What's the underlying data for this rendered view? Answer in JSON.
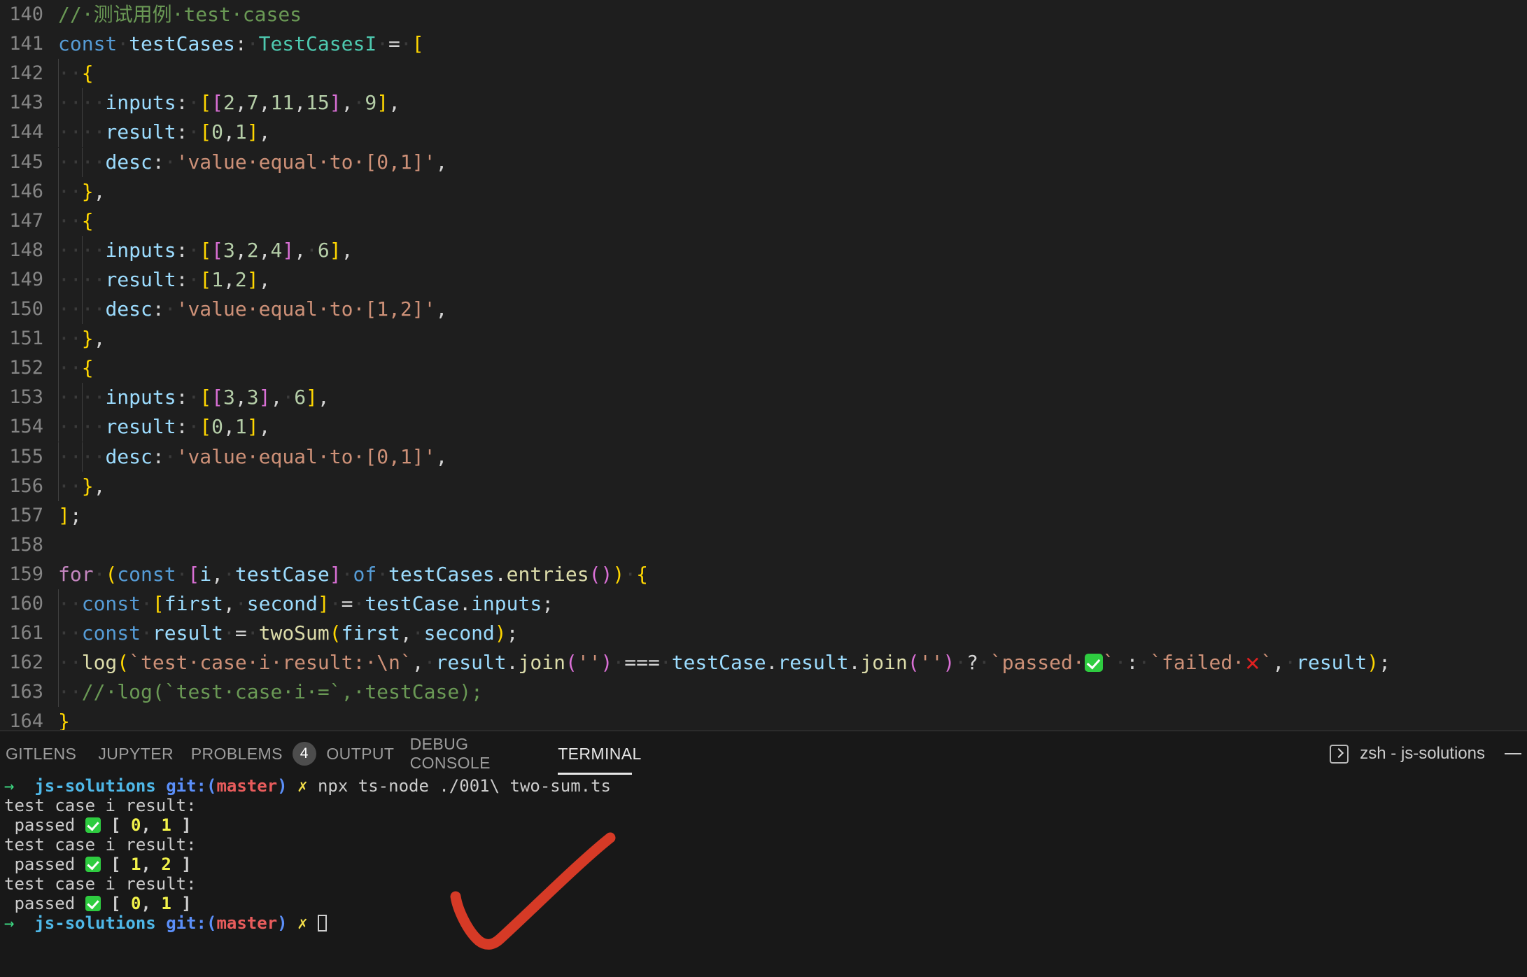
{
  "editor": {
    "first_line_number": 140,
    "lines": [
      {
        "n": 140,
        "text": "// 测试用例 test cases"
      },
      {
        "n": 141,
        "text": "const testCases: TestCasesI = ["
      },
      {
        "n": 142,
        "text": "  {"
      },
      {
        "n": 143,
        "text": "    inputs: [[2,7,11,15], 9],"
      },
      {
        "n": 144,
        "text": "    result: [0,1],"
      },
      {
        "n": 145,
        "text": "    desc: 'value equal to [0,1]',"
      },
      {
        "n": 146,
        "text": "  },"
      },
      {
        "n": 147,
        "text": "  {"
      },
      {
        "n": 148,
        "text": "    inputs: [[3,2,4], 6],"
      },
      {
        "n": 149,
        "text": "    result: [1,2],"
      },
      {
        "n": 150,
        "text": "    desc: 'value equal to [1,2]',"
      },
      {
        "n": 151,
        "text": "  },"
      },
      {
        "n": 152,
        "text": "  {"
      },
      {
        "n": 153,
        "text": "    inputs: [[3,3], 6],"
      },
      {
        "n": 154,
        "text": "    result: [0,1],"
      },
      {
        "n": 155,
        "text": "    desc: 'value equal to [0,1]',"
      },
      {
        "n": 156,
        "text": "  },"
      },
      {
        "n": 157,
        "text": "];"
      },
      {
        "n": 158,
        "text": ""
      },
      {
        "n": 159,
        "text": "for (const [i, testCase] of testCases.entries()) {"
      },
      {
        "n": 160,
        "text": "  const [first, second] = testCase.inputs;"
      },
      {
        "n": 161,
        "text": "  const result = twoSum(first, second);"
      },
      {
        "n": 162,
        "text": "  log(`test case i result: \\n`, result.join('') === testCase.result.join('') ? `passed ✅` : `failed ❌`, result);"
      },
      {
        "n": 163,
        "text": "  // log(`test case i =`, testCase);"
      },
      {
        "n": 164,
        "text": "}"
      }
    ]
  },
  "panel": {
    "tabs": [
      {
        "label": "GITLENS",
        "active": false,
        "badge": null
      },
      {
        "label": "JUPYTER",
        "active": false,
        "badge": null
      },
      {
        "label": "PROBLEMS",
        "active": false,
        "badge": "4"
      },
      {
        "label": "OUTPUT",
        "active": false,
        "badge": null
      },
      {
        "label": "DEBUG CONSOLE",
        "active": false,
        "badge": null
      },
      {
        "label": "TERMINAL",
        "active": true,
        "badge": null
      }
    ],
    "terminal_selector_label": "zsh - js-solutions",
    "terminal_icon": "terminal-icon",
    "minimize_icon": "minimize-icon"
  },
  "terminal": {
    "prompt_arrow": "→",
    "prompt_dir": "js-solutions",
    "prompt_git_prefix": "git:(",
    "prompt_branch": "master",
    "prompt_git_suffix": ")",
    "prompt_status": "✗",
    "command": "npx ts-node ./001\\ two-sum.ts",
    "results": [
      {
        "header": "test case i result:",
        "status": "passed",
        "values": "[ 0, 1 ]"
      },
      {
        "header": "test case i result:",
        "status": "passed",
        "values": "[ 1, 2 ]"
      },
      {
        "header": "test case i result:",
        "status": "passed",
        "values": "[ 0, 1 ]"
      }
    ]
  },
  "annotation": {
    "type": "hand-drawn-checkmark",
    "color": "#d63a26"
  },
  "colors": {
    "editor_bg": "#1e1e1e",
    "panel_bg": "#181818",
    "line_number": "#858585",
    "comment": "#6A9955",
    "keyword": "#569CD6",
    "control": "#C586C0",
    "variable": "#9CDCFE",
    "type": "#4EC9B0",
    "function": "#DCDCAA",
    "number": "#B5CEA8",
    "string": "#CE9178",
    "bracket1": "#FFD700",
    "bracket2": "#DA70D6",
    "bracket3": "#179FFF",
    "annotation_red": "#d63a26"
  }
}
